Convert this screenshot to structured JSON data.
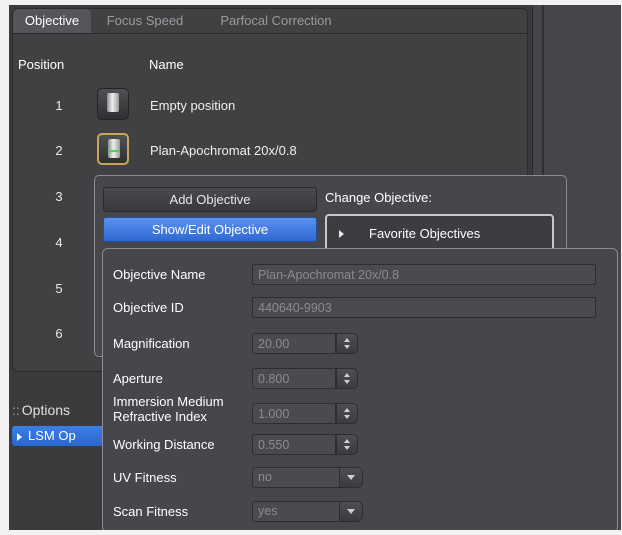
{
  "tabs": [
    {
      "label": "Objective",
      "active": true
    },
    {
      "label": "Focus Speed",
      "active": false
    },
    {
      "label": "Parfocal Correction",
      "active": false
    }
  ],
  "table": {
    "headers": {
      "position": "Position",
      "name": "Name"
    },
    "positions": [
      "1",
      "2",
      "3",
      "4",
      "5",
      "6"
    ],
    "objectives": [
      {
        "position": "1",
        "name": "Empty position",
        "icon": "objective-lens-icon"
      },
      {
        "position": "2",
        "name": "Plan-Apochromat 20x/0.8",
        "icon": "objective-lens-icon",
        "selected": true
      }
    ]
  },
  "objective_menu": {
    "add_button": "Add Objective",
    "show_edit_button": "Show/Edit Objective",
    "change_label": "Change Objective:",
    "favorite_objectives": "Favorite Objectives"
  },
  "options": {
    "title": "Options",
    "dots": "::",
    "item": "LSM Op"
  },
  "details": {
    "objective_name": {
      "label": "Objective Name",
      "value": "Plan-Apochromat 20x/0.8"
    },
    "objective_id": {
      "label": "Objective ID",
      "value": "440640-9903"
    },
    "magnification": {
      "label": "Magnification",
      "value": "20.00"
    },
    "aperture": {
      "label": "Aperture",
      "value": "0.800"
    },
    "refractive_index": {
      "label_line1": "Immersion Medium",
      "label_line2": "Refractive Index",
      "value": "1.000"
    },
    "working_distance": {
      "label": "Working Distance",
      "value": "0.550"
    },
    "uv_fitness": {
      "label": "UV Fitness",
      "value": "no"
    },
    "scan_fitness": {
      "label": "Scan Fitness",
      "value": "yes"
    }
  },
  "colors": {
    "accent_blue": "#3c7fe8",
    "selected_border": "#c8a55a",
    "panel_bg": "#404143"
  }
}
